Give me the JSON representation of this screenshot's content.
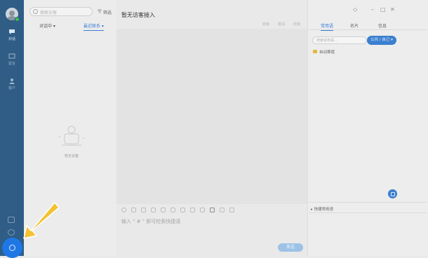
{
  "nav": {
    "items": [
      {
        "label": "对话",
        "icon": "chat-bubble-icon",
        "active": true
      },
      {
        "label": "留言",
        "icon": "message-icon",
        "active": false
      },
      {
        "label": "客户",
        "icon": "person-icon",
        "active": false
      }
    ],
    "bottom_icons": [
      "mail-icon",
      "info-icon",
      "settings-gear-icon"
    ]
  },
  "list": {
    "search_placeholder": "搜索访客",
    "filter_label": "筛选",
    "tab_left": "对话中 ▾",
    "tab_right": "最近联系 ▾",
    "empty_text": "暂无访客"
  },
  "chat": {
    "title": "暂无访客接入",
    "actions": [
      "转接",
      "邀请",
      "结束"
    ],
    "input_placeholder": "输入 \" # \" 即可检索快捷语",
    "send_label": "发送"
  },
  "right": {
    "tabs": [
      "常用语",
      "名片",
      "信息"
    ],
    "search_placeholder": "搜索常用语...",
    "scope_label": "公共 / 自己 ▾",
    "folder_label": "自动寒暄",
    "quick_label": "▸ 快捷常用语"
  },
  "colors": {
    "sidebar": "#2f5d86",
    "accent": "#3b7fd0",
    "highlight_button": "#1f77e5",
    "pointer_arrow": "#f2c230"
  }
}
